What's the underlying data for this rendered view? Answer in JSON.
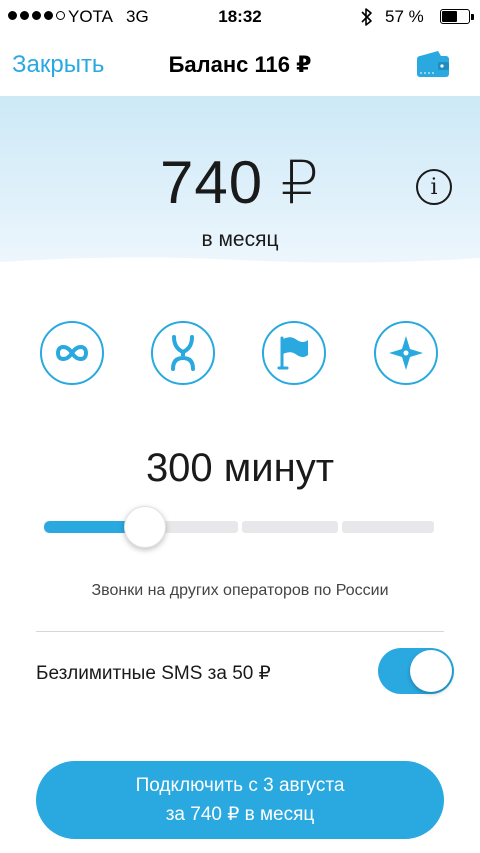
{
  "status_bar": {
    "signal_filled": 4,
    "signal_total": 5,
    "carrier": "YOTA",
    "network": "3G",
    "time": "18:32",
    "battery_text": "57 %",
    "battery_level": 0.57,
    "bluetooth_icon": "bluetooth-icon"
  },
  "nav": {
    "close_label": "Закрыть",
    "title": "Баланс 116 ₽",
    "wallet_icon": "wallet-icon"
  },
  "tariff": {
    "price": "740 ₽",
    "period": "в месяц",
    "info_glyph": "i"
  },
  "options": [
    {
      "icon": "infinity-icon"
    },
    {
      "icon": "yota-logo-icon"
    },
    {
      "icon": "flag-icon"
    },
    {
      "icon": "compass-icon"
    }
  ],
  "minutes": {
    "label": "300 минут",
    "slider_value": 0.26,
    "description": "Звонки на других операторов по России"
  },
  "sms": {
    "label": "Безлимитные SMS за 50 ₽",
    "enabled": true
  },
  "cta": {
    "line1": "Подключить с 3 августа",
    "line2": "за 740 ₽ в месяц"
  },
  "colors": {
    "accent": "#29a9e0",
    "hero_top": "#cde9f7",
    "text": "#1a1a1a"
  }
}
